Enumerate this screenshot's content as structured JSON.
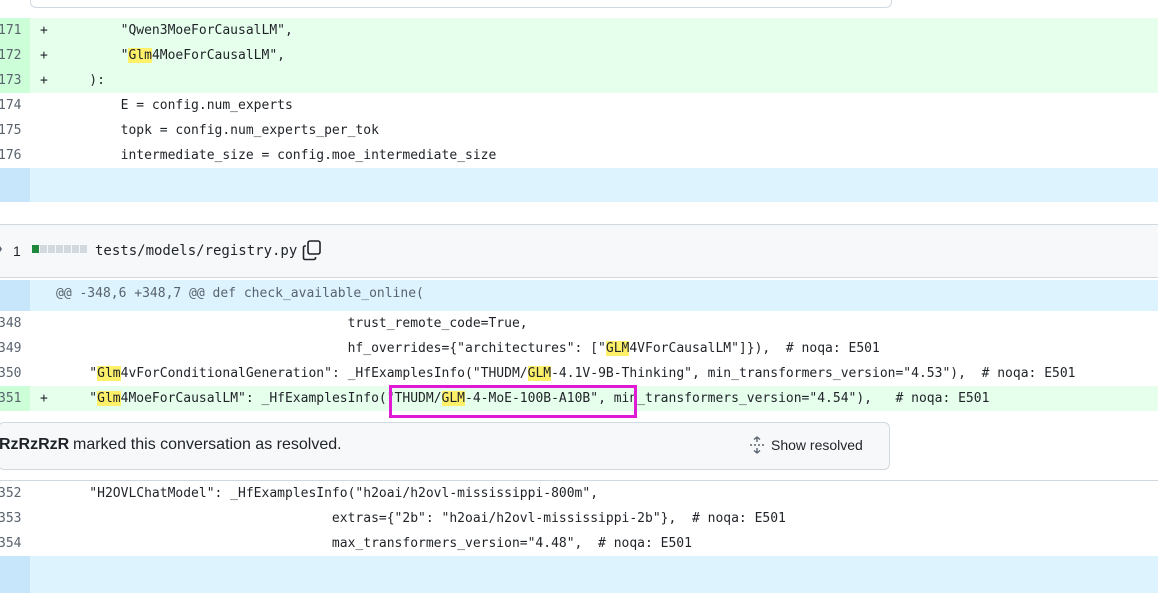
{
  "diff1": {
    "lines": [
      {
        "num": "171",
        "marker": "+",
        "type": "add",
        "pre": "        \"Qwen3MoeForCausalLM\",",
        "hl": "",
        "post": ""
      },
      {
        "num": "172",
        "marker": "+",
        "type": "add",
        "pre": "        \"",
        "hl": "Glm",
        "post": "4MoeForCausalLM\","
      },
      {
        "num": "173",
        "marker": "+",
        "type": "add",
        "pre": "    ):",
        "hl": "",
        "post": ""
      },
      {
        "num": "174",
        "marker": "",
        "type": "ctx",
        "pre": "        E = config.num_experts",
        "hl": "",
        "post": ""
      },
      {
        "num": "175",
        "marker": "",
        "type": "ctx",
        "pre": "        topk = config.num_experts_per_tok",
        "hl": "",
        "post": ""
      },
      {
        "num": "176",
        "marker": "",
        "type": "ctx",
        "pre": "        intermediate_size = config.moe_intermediate_size",
        "hl": "",
        "post": ""
      }
    ]
  },
  "file2": {
    "change_count": "1",
    "path": "tests/models/registry.py",
    "hunk_header": "@@ -348,6 +348,7 @@ def check_available_online(",
    "lines_before": [
      {
        "num": "348",
        "marker": "",
        "type": "ctx",
        "segments": [
          {
            "t": "                                     trust_remote_code=True,"
          }
        ]
      },
      {
        "num": "349",
        "marker": "",
        "type": "ctx",
        "segments": [
          {
            "t": "                                     hf_overrides={\"architectures\": [\""
          },
          {
            "t": "GLM",
            "hl": true
          },
          {
            "t": "4VForCausalLM\"]}),  # noqa: E501"
          }
        ]
      },
      {
        "num": "350",
        "marker": "",
        "type": "ctx",
        "segments": [
          {
            "t": "    \""
          },
          {
            "t": "Glm",
            "hl": true
          },
          {
            "t": "4vForConditionalGeneration\": _HfExamplesInfo(\"THUDM/"
          },
          {
            "t": "GLM",
            "hl": true
          },
          {
            "t": "-4.1V-9B-Thinking\", min_transformers_version=\"4.53\"),  # noqa: E501"
          }
        ]
      },
      {
        "num": "351",
        "marker": "+",
        "type": "add",
        "segments": [
          {
            "t": "    \""
          },
          {
            "t": "Glm",
            "hl": true
          },
          {
            "t": "4MoeForCausalLM\": _HfExamplesInfo(\"THUDM/"
          },
          {
            "t": "GLM",
            "hl": true
          },
          {
            "t": "-4-MoE-100B-A10B\", min_transformers_version=\"4.54\"),   # noqa: E501"
          }
        ]
      }
    ],
    "resolved": {
      "user": "RzRzRzR",
      "message": "marked this conversation as resolved.",
      "show_resolved_label": "Show resolved"
    },
    "lines_after": [
      {
        "num": "352",
        "marker": "",
        "type": "ctx",
        "segments": [
          {
            "t": "    \"H2OVLChatModel\": _HfExamplesInfo(\"h2oai/h2ovl-mississippi-800m\","
          }
        ]
      },
      {
        "num": "353",
        "marker": "",
        "type": "ctx",
        "segments": [
          {
            "t": "                                   extras={\"2b\": \"h2oai/h2ovl-mississippi-2b\"},  # noqa: E501"
          }
        ]
      },
      {
        "num": "354",
        "marker": "",
        "type": "ctx",
        "segments": [
          {
            "t": "                                   max_transformers_version=\"4.48\",  # noqa: E501"
          }
        ]
      }
    ]
  },
  "colors": {
    "add_bg": "#e6ffec",
    "hunk_bg": "#ddf4ff",
    "highlight": "#fff06a",
    "annotation_box": "#e01ad4"
  }
}
